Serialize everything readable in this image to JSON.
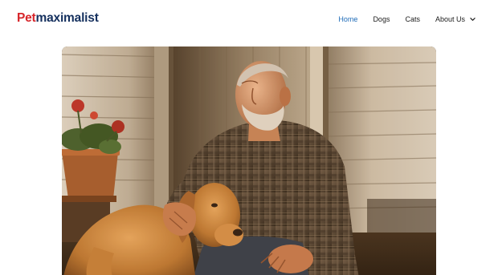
{
  "site": {
    "logo_part_a": "Pet",
    "logo_part_b": "maximalist"
  },
  "nav": {
    "items": [
      {
        "label": "Home",
        "active": true
      },
      {
        "label": "Dogs",
        "active": false
      },
      {
        "label": "Cats",
        "active": false
      },
      {
        "label": "About Us",
        "active": false,
        "has_dropdown": true
      }
    ]
  },
  "colors": {
    "brand_red": "#d7262b",
    "brand_navy": "#15305e",
    "nav_active": "#1e6bb8",
    "nav_text": "#1b1b1b"
  },
  "icons": {
    "about_dropdown": "chevron-down-icon"
  }
}
